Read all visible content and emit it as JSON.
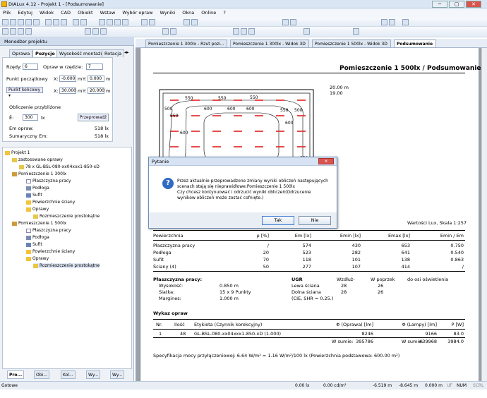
{
  "window": {
    "title": "DIALux 4.12 - Projekt 1 - [Podsumowanie]",
    "min": "─",
    "max": "▢",
    "close": "✕"
  },
  "menu": [
    "Plik",
    "Edytuj",
    "Widok",
    "CAD",
    "Obiekt",
    "Wstaw",
    "Wybór opraw",
    "Wyniki",
    "Okna",
    "Online",
    "?"
  ],
  "left_panel": {
    "title": "Menedżer projektu",
    "tabs": [
      "Oprawa",
      "Pozycje",
      "Wysokość montażu",
      "Rotacja"
    ],
    "rows_label": "Rzędy:",
    "rows_value": "6",
    "per_row_label": "Opraw w rzędzie:",
    "per_row_value": "7",
    "start_label": "Punkt początkowy",
    "x_label": "X:",
    "start_x": "-0.000",
    "y_label": "Y:",
    "start_y": "0.000",
    "unit_m": "m",
    "end_select": "Punkt końcowy",
    "end_x": "30.000",
    "end_y": "20.000",
    "calc_label": "Obliczenie przybliżone",
    "e_label": "Ē:",
    "e_value": "300",
    "lx": "lx",
    "adjust_button": "Przeprowadź",
    "em_label": "Em opraw:",
    "em_value": "518 lx",
    "sum_label": "Sumaryczny Em:",
    "sum_value": "518 lx"
  },
  "tree": [
    {
      "label": "Projekt 1",
      "depth": 0,
      "icon": "folder-icon"
    },
    {
      "label": "zastosowane oprawy",
      "depth": 1,
      "icon": "luminaire-icon"
    },
    {
      "label": "78 x GL-BSL-080-xx04xxx1-850-xD",
      "depth": 2,
      "icon": "luminaire-icon"
    },
    {
      "label": "Pomieszczenie 1 300lx",
      "depth": 1,
      "icon": "room-icon"
    },
    {
      "label": "Płaszczyzna pracy",
      "depth": 2,
      "icon": "plane-icon"
    },
    {
      "label": "Podłoga",
      "depth": 2,
      "icon": "floor-icon"
    },
    {
      "label": "Sufit",
      "depth": 2,
      "icon": "ceiling-icon"
    },
    {
      "label": "Powierzchnie ściany",
      "depth": 2,
      "icon": "folder-icon"
    },
    {
      "label": "Oprawy",
      "depth": 2,
      "icon": "folder-icon"
    },
    {
      "label": "Rozmieszczenie prostokątne",
      "depth": 3,
      "icon": "luminaire-icon"
    },
    {
      "label": "Pomieszczenie 1 500lx",
      "depth": 1,
      "icon": "room-icon"
    },
    {
      "label": "Płaszczyzna pracy",
      "depth": 2,
      "icon": "plane-icon"
    },
    {
      "label": "Podłoga",
      "depth": 2,
      "icon": "floor-icon"
    },
    {
      "label": "Sufit",
      "depth": 2,
      "icon": "ceiling-icon"
    },
    {
      "label": "Powierzchnie ściany",
      "depth": 2,
      "icon": "folder-icon"
    },
    {
      "label": "Oprawy",
      "depth": 2,
      "icon": "folder-icon"
    },
    {
      "label": "Rozmieszczenie prostokątne",
      "depth": 3,
      "icon": "luminaire-icon"
    }
  ],
  "bottom_tabs": [
    "Pro...",
    "Obi...",
    "Kol...",
    "Wy...",
    "Wy..."
  ],
  "doc_tabs": [
    "Pomieszczenie 1 300lx - Rzut pozi...",
    "Pomieszczenie 1 300lx - Widok 3D",
    "Pomieszczenie 1 500lx - Widok 3D",
    "Podsumowanie"
  ],
  "report": {
    "title": "Pomieszczenie 1 500lx / Podsumowanie",
    "dim1": "20.00 m",
    "dim2": "19.00",
    "isolines": [
      "550",
      "550",
      "550",
      "500",
      "600",
      "600",
      "600",
      "550",
      "600",
      "550",
      "500",
      "550",
      "600",
      "550"
    ],
    "scale_text": "Wartości Lux, Skala 1:257",
    "table_headers": [
      "Powierzchnia",
      "ρ [%]",
      "Em [lx]",
      "Emin [lx]",
      "Emax [lx]",
      "Emin / Em"
    ],
    "rows": [
      [
        "Płaszczyzna pracy",
        "/",
        "574",
        "430",
        "653",
        "0.750"
      ],
      [
        "Podłoga",
        "20",
        "523",
        "282",
        "641",
        "0.540"
      ],
      [
        "Sufit",
        "70",
        "118",
        "101",
        "138",
        "0.863"
      ],
      [
        "Ściany (4)",
        "50",
        "277",
        "107",
        "414",
        "/"
      ]
    ],
    "work_plane": {
      "heading": "Płaszczyzna pracy:",
      "height_label": "Wysokość:",
      "height": "0.850 m",
      "grid_label": "Siatka:",
      "grid": "15 x 9 Punkty",
      "margin_label": "Margines:",
      "margin": "1.000 m"
    },
    "ugr": {
      "heading": "UGR",
      "cols": [
        "Wzdłuż-",
        "W poprzek",
        "do osi oświetlenia"
      ],
      "left_wall": "Lewa ściana",
      "left_vals": [
        "28",
        "26"
      ],
      "bottom_wall": "Dolna ściana",
      "bottom_vals": [
        "28",
        "26"
      ],
      "note": "(CIE, SHR = 0.25.)"
    },
    "lum_heading": "Wykaz opraw",
    "lum_headers": [
      "Nr.",
      "Ilość",
      "Etykieta (Czynnik korekcyjny)",
      "Φ (Oprawa) [lm]",
      "Φ (Lampy) [lm]",
      "P [W]"
    ],
    "lum_row": [
      "1",
      "48",
      "GL-BSL-080-xx04xxx1-850-xD (1.000)",
      "8246",
      "9166",
      "83.0"
    ],
    "sum_row": [
      "W sumie:",
      "395786",
      "W sumie:",
      "439968",
      "3984.0"
    ],
    "spec": "Specyfikacja mocy przyłączeniowej: 6.64 W/m² = 1.16 W/m²/100 lx (Powierzchnia podstawowa: 600.00 m²)"
  },
  "dialog": {
    "title": "Pytanie",
    "message_1": "Przez aktualnie przeprowadzone zmiany wyniki obliczeń następujących",
    "message_2": "scenach stają się nieprawidłowe:Pomieszczenie 1 500lx",
    "message_3": "Czy chcesz kontynuować i odrzucić wyniki obliczeń(Odrzucenie",
    "message_4": "wyników obliczeń może zostać cofnięte.)",
    "yes": "Tak",
    "no": "Nie"
  },
  "status": {
    "ready": "Gotowe",
    "lx": "0.00 lx",
    "lum": "0.00 cd/m²",
    "x": "-6.519 m",
    "y": "-8.645 m",
    "z": "0.000 m",
    "uf": "UF",
    "num": "NUM",
    "scrl": "SCRL"
  }
}
